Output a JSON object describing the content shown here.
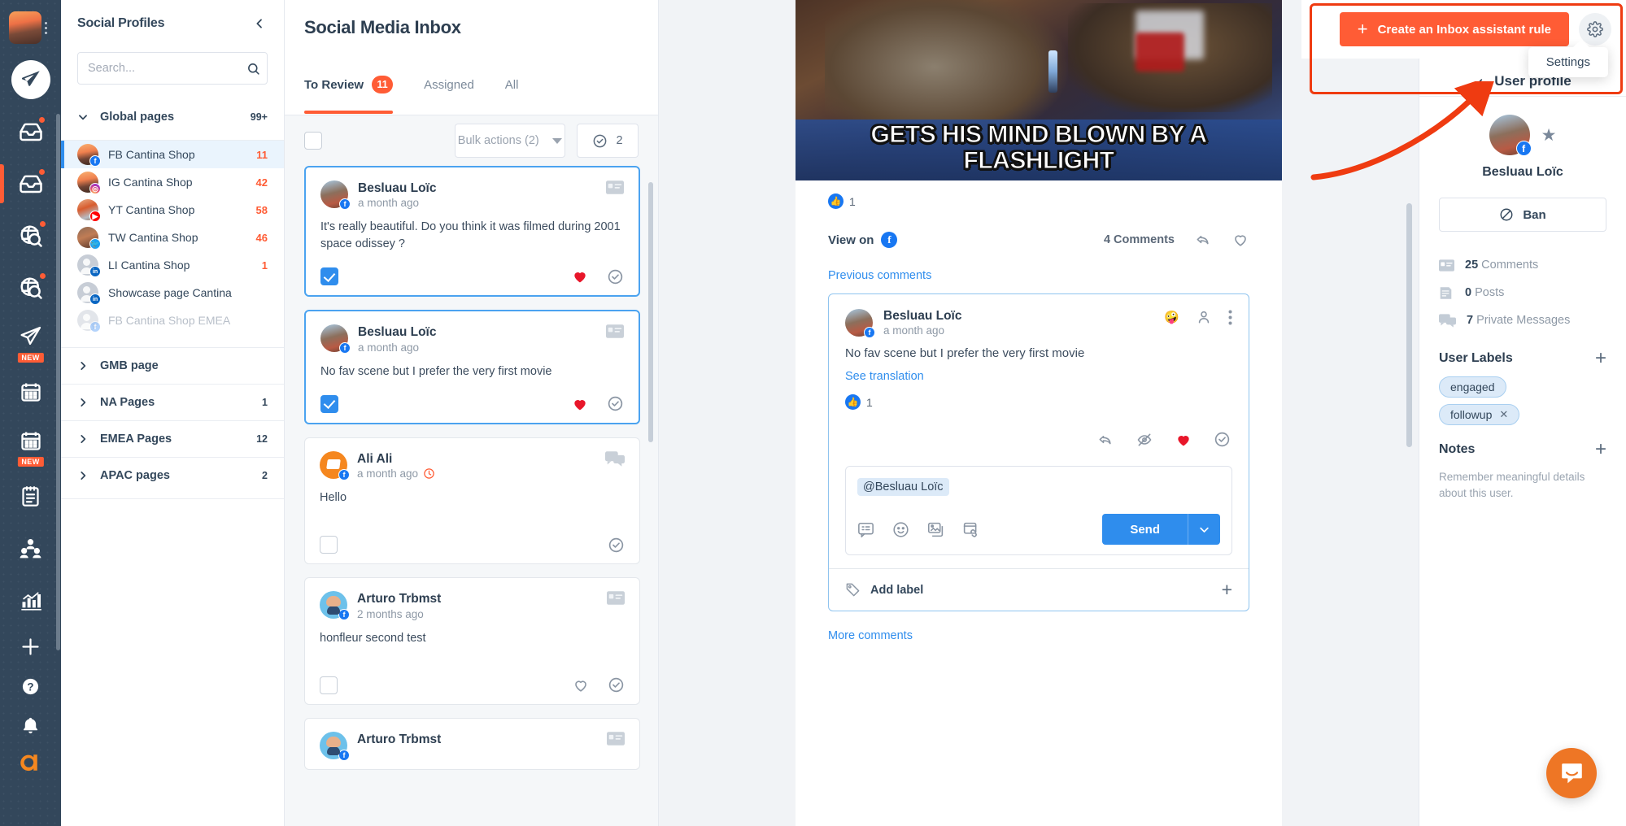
{
  "rail": {
    "logo_name": "app-logo",
    "items": [
      {
        "name": "publish-icon",
        "badge": null,
        "dot": false,
        "active": false
      },
      {
        "name": "inbox-icon",
        "badge": null,
        "dot": true,
        "active": false
      },
      {
        "name": "inbox-active-icon",
        "badge": null,
        "dot": true,
        "active": true
      },
      {
        "name": "listening-icon",
        "badge": null,
        "dot": true,
        "active": false
      },
      {
        "name": "monitoring-icon",
        "badge": null,
        "dot": true,
        "active": false
      },
      {
        "name": "publish-new-icon",
        "badge": "NEW",
        "dot": false,
        "active": false
      },
      {
        "name": "calendar-icon",
        "badge": null,
        "dot": false,
        "active": false
      },
      {
        "name": "calendar-new-icon",
        "badge": "NEW",
        "dot": false,
        "active": false
      },
      {
        "name": "reports-icon",
        "badge": null,
        "dot": false,
        "active": false
      },
      {
        "name": "team-icon",
        "badge": null,
        "dot": false,
        "active": false
      },
      {
        "name": "analytics-icon",
        "badge": null,
        "dot": false,
        "active": false
      },
      {
        "name": "add-icon",
        "badge": null,
        "dot": false,
        "active": false
      },
      {
        "name": "help-icon",
        "badge": null,
        "dot": false,
        "active": false
      },
      {
        "name": "notifications-icon",
        "badge": null,
        "dot": false,
        "active": false
      },
      {
        "name": "agorapulse-logo",
        "badge": null,
        "dot": false,
        "active": false
      }
    ]
  },
  "profiles": {
    "title": "Social Profiles",
    "collapse_label": "collapse",
    "search": {
      "placeholder": "Search...",
      "value": ""
    },
    "global_group": {
      "label": "Global pages",
      "count": "99+"
    },
    "pages": [
      {
        "name": "FB Cantina Shop",
        "count": "11",
        "network": "fb",
        "selected": true,
        "dim": false
      },
      {
        "name": "IG Cantina Shop",
        "count": "42",
        "network": "ig",
        "selected": false,
        "dim": false
      },
      {
        "name": "YT Cantina Shop",
        "count": "58",
        "network": "yt",
        "selected": false,
        "dim": false
      },
      {
        "name": "TW Cantina Shop",
        "count": "46",
        "network": "tw",
        "selected": false,
        "dim": false
      },
      {
        "name": "LI Cantina Shop",
        "count": "1",
        "network": "li",
        "selected": false,
        "dim": false
      },
      {
        "name": "Showcase page Cantina",
        "count": "",
        "network": "li",
        "selected": false,
        "dim": false
      },
      {
        "name": "FB Cantina Shop EMEA",
        "count": "",
        "network": "fb",
        "selected": false,
        "dim": true
      }
    ],
    "groups": [
      {
        "label": "GMB page",
        "count": ""
      },
      {
        "label": "NA Pages",
        "count": "1"
      },
      {
        "label": "EMEA Pages",
        "count": "12"
      },
      {
        "label": "APAC pages",
        "count": "2"
      }
    ]
  },
  "inbox": {
    "title": "Social Media Inbox",
    "tabs": [
      {
        "label": "To Review",
        "badge": "11",
        "active": true
      },
      {
        "label": "Assigned",
        "badge": "",
        "active": false
      },
      {
        "label": "All",
        "badge": "",
        "active": false
      }
    ],
    "bulk_actions_label": "Bulk actions (2)",
    "selected_count": "2",
    "conversations": [
      {
        "author": "Besluau Loïc",
        "time": "a month ago",
        "text": "It's really beautiful. Do you think it was filmed during 2001 space odissey ?",
        "checked": true,
        "selected": true,
        "type_icon": "comment-card-icon",
        "has_overdue": false,
        "heart_filled": true,
        "has_heart": true
      },
      {
        "author": "Besluau Loïc",
        "time": "a month ago",
        "text": "No fav scene but I prefer the very first movie",
        "checked": true,
        "selected": true,
        "type_icon": "comment-card-icon",
        "has_overdue": false,
        "heart_filled": true,
        "has_heart": true
      },
      {
        "author": "Ali Ali",
        "time": "a month ago",
        "text": "Hello",
        "checked": false,
        "selected": false,
        "type_icon": "private-message-icon",
        "has_overdue": true,
        "heart_filled": false,
        "has_heart": false
      },
      {
        "author": "Arturo Trbmst",
        "time": "2 months ago",
        "text": "honfleur second test",
        "checked": false,
        "selected": false,
        "type_icon": "comment-card-icon",
        "has_overdue": false,
        "heart_filled": false,
        "has_heart": true
      },
      {
        "author": "Arturo Trbmst",
        "time": "",
        "text": "",
        "checked": false,
        "selected": false,
        "type_icon": "comment-card-icon",
        "has_overdue": false,
        "heart_filled": false,
        "has_heart": false
      }
    ]
  },
  "detail": {
    "post_image_text_line1": "GETS HIS MIND BLOWN BY A",
    "post_image_text_line2": "FLASHLIGHT",
    "post_likes": "1",
    "view_on_label": "View on",
    "comments_count_label": "4 Comments",
    "previous_comments_label": "Previous comments",
    "more_comments_label": "More comments",
    "comment": {
      "author": "Besluau Loïc",
      "time": "a month ago",
      "text": "No fav scene but I prefer the very first movie",
      "see_translation_label": "See translation",
      "likes": "1",
      "reaction_emoji": "🤪"
    },
    "reply": {
      "mention": "@Besluau Loïc",
      "send_label": "Send"
    },
    "add_label_text": "Add label"
  },
  "user_panel": {
    "title": "User profile",
    "name": "Besluau Loïc",
    "ban_label": "Ban",
    "stats": [
      {
        "icon": "comment-card-icon",
        "value": "25",
        "label": "Comments"
      },
      {
        "icon": "post-icon",
        "value": "0",
        "label": "Posts"
      },
      {
        "icon": "private-message-icon",
        "value": "7",
        "label": "Private Messages"
      }
    ],
    "labels_title": "User Labels",
    "labels": [
      {
        "text": "engaged",
        "removable": false
      },
      {
        "text": "followup",
        "removable": true
      }
    ],
    "notes_title": "Notes",
    "notes_placeholder": "Remember meaningful details about this user."
  },
  "overlay": {
    "cta_label": "Create an Inbox assistant rule",
    "settings_tooltip": "Settings"
  },
  "colors": {
    "brand_orange": "#ff5c35",
    "accent_blue": "#2f8ded",
    "navy": "#33475b",
    "heart_red": "#e8162a",
    "highlight": "#ef3b11"
  }
}
